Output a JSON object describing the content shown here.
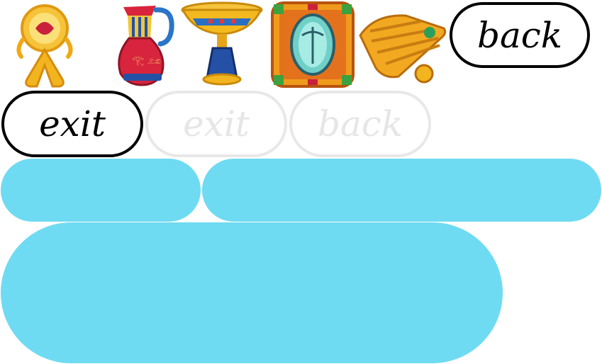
{
  "colors": {
    "panel": "#6fdbf2",
    "button_border": "#000000",
    "button_disabled": "#e8e8e8",
    "gold": "#f5b21d",
    "red": "#d8243c",
    "blue": "#2451a6"
  },
  "inventory": {
    "items": [
      {
        "icon": "ankh-amulet-icon"
      },
      {
        "icon": "jug-vase-icon"
      },
      {
        "icon": "chalice-goblet-icon"
      },
      {
        "icon": "scarab-tile-icon"
      },
      {
        "icon": "papyrus-scrolls-icon"
      }
    ]
  },
  "buttons": {
    "back_top": "back",
    "exit": "exit",
    "exit_disabled": "exit",
    "back_disabled": "back"
  }
}
